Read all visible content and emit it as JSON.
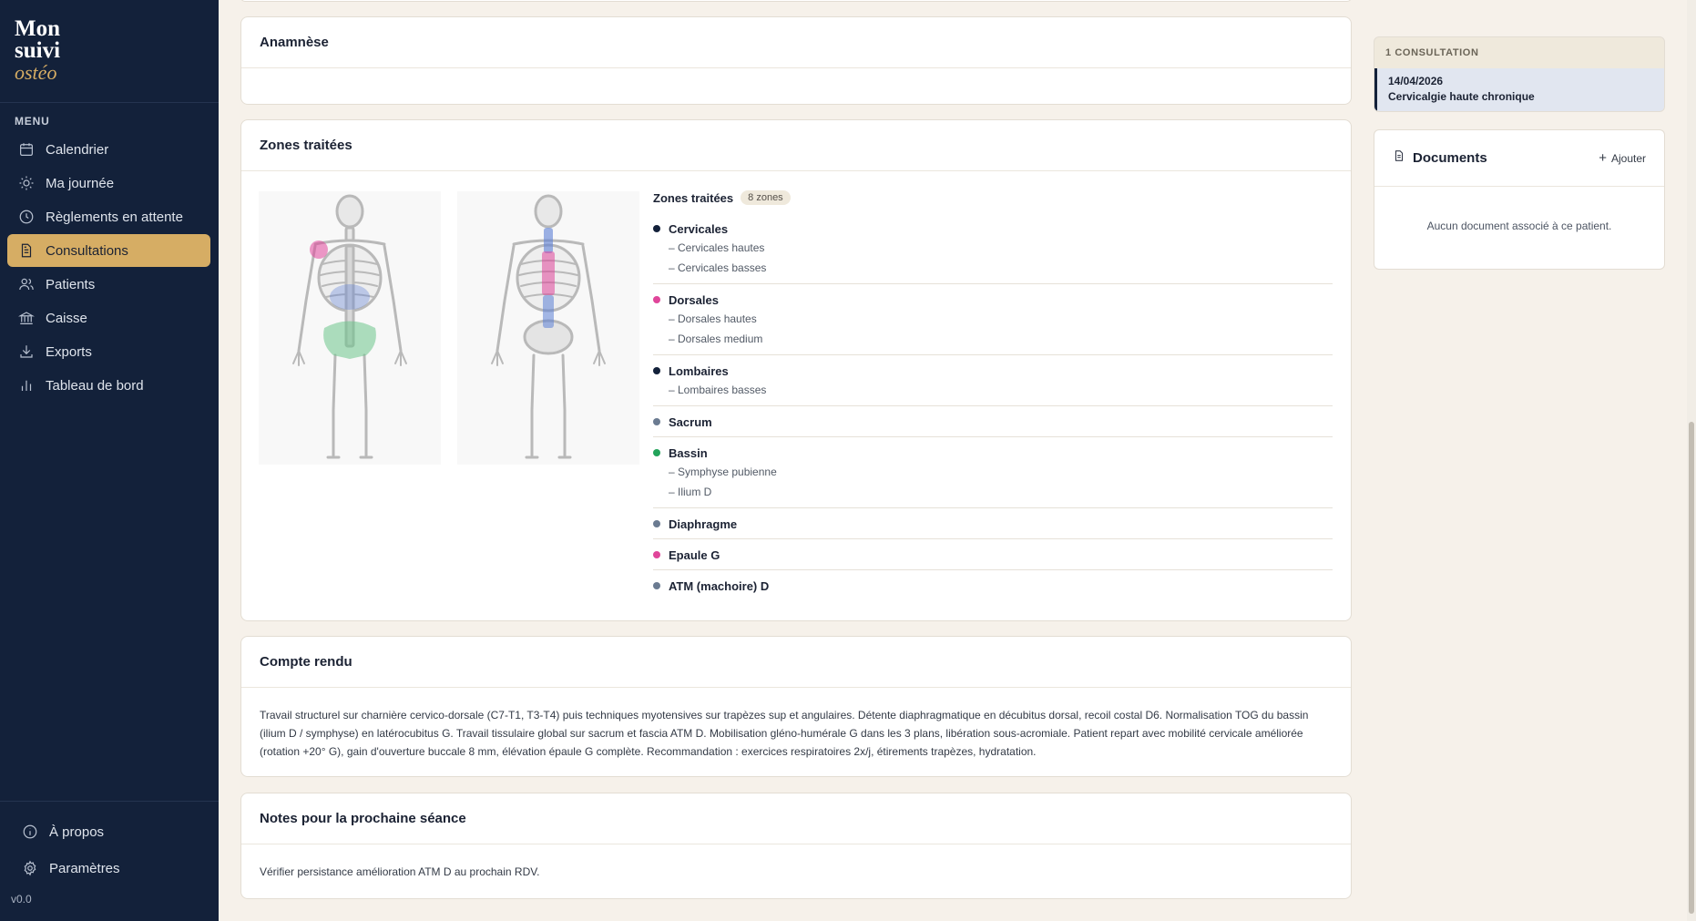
{
  "app": {
    "logo": [
      "Mon",
      "suivi",
      "ostéo"
    ],
    "version": "v0.0"
  },
  "sidebar": {
    "menu_title": "MENU",
    "items": [
      {
        "label": "Calendrier",
        "icon": "calendar-icon",
        "active": false
      },
      {
        "label": "Ma journée",
        "icon": "sun-icon",
        "active": false
      },
      {
        "label": "Règlements en attente",
        "icon": "clock-icon",
        "active": false
      },
      {
        "label": "Consultations",
        "icon": "document-icon",
        "active": true
      },
      {
        "label": "Patients",
        "icon": "users-icon",
        "active": false
      },
      {
        "label": "Caisse",
        "icon": "bank-icon",
        "active": false
      },
      {
        "label": "Exports",
        "icon": "download-icon",
        "active": false
      },
      {
        "label": "Tableau de bord",
        "icon": "bar-chart-icon",
        "active": false
      }
    ],
    "bottom_items": [
      {
        "label": "À propos",
        "icon": "info-icon"
      },
      {
        "label": "Paramètres",
        "icon": "gear-icon"
      }
    ]
  },
  "anamnese": {
    "title": "Anamnèse"
  },
  "zones": {
    "card_title": "Zones traitées",
    "panel_title": "Zones traitées",
    "count_badge": "8 zones",
    "groups": [
      {
        "name": "Cervicales",
        "color": "#13213a",
        "subs": [
          "– Cervicales hautes",
          "– Cervicales basses"
        ]
      },
      {
        "name": "Dorsales",
        "color": "#e0469a",
        "subs": [
          "– Dorsales hautes",
          "– Dorsales medium"
        ]
      },
      {
        "name": "Lombaires",
        "color": "#13213a",
        "subs": [
          "– Lombaires basses"
        ]
      },
      {
        "name": "Sacrum",
        "color": "#6b7b91",
        "subs": []
      },
      {
        "name": "Bassin",
        "color": "#22a35a",
        "subs": [
          "– Symphyse pubienne",
          "– Ilium D"
        ]
      },
      {
        "name": "Diaphragme",
        "color": "#6b7b91",
        "subs": []
      },
      {
        "name": "Epaule G",
        "color": "#e0469a",
        "subs": []
      },
      {
        "name": "ATM (machoire) D",
        "color": "#6b7b91",
        "subs": []
      }
    ]
  },
  "compte_rendu": {
    "title": "Compte rendu",
    "text": "Travail structurel sur charnière cervico-dorsale (C7-T1, T3-T4) puis techniques myotensives sur trapèzes sup et angulaires. Détente diaphragmatique en décubitus dorsal, recoil costal D6. Normalisation TOG du bassin (ilium D / symphyse) en latérocubitus G. Travail tissulaire global sur sacrum et fascia ATM D. Mobilisation gléno-humérale G dans les 3 plans, libération sous-acromiale. Patient repart avec mobilité cervicale améliorée (rotation +20° G), gain d'ouverture buccale 8 mm, élévation épaule G complète. Recommandation : exercices respiratoires 2x/j, étirements trapèzes, hydratation."
  },
  "notes": {
    "title": "Notes pour la prochaine séance",
    "text": "Vérifier persistance amélioration ATM D au prochain RDV."
  },
  "consultations": {
    "header": "1 CONSULTATION",
    "items": [
      {
        "date": "14/04/2026",
        "title": "Cervicalgie haute chronique"
      }
    ]
  },
  "documents": {
    "title": "Documents",
    "add_label": "Ajouter",
    "empty_text": "Aucun document associé à ce patient."
  },
  "colors": {
    "sidebar_bg": "#13213a",
    "accent": "#d6ad64",
    "page_bg": "#f6f1ea",
    "dorsal_highlight": "#e0469a",
    "lumbar_highlight": "#5b7fd6",
    "pelvis_highlight": "#6cc58a"
  }
}
